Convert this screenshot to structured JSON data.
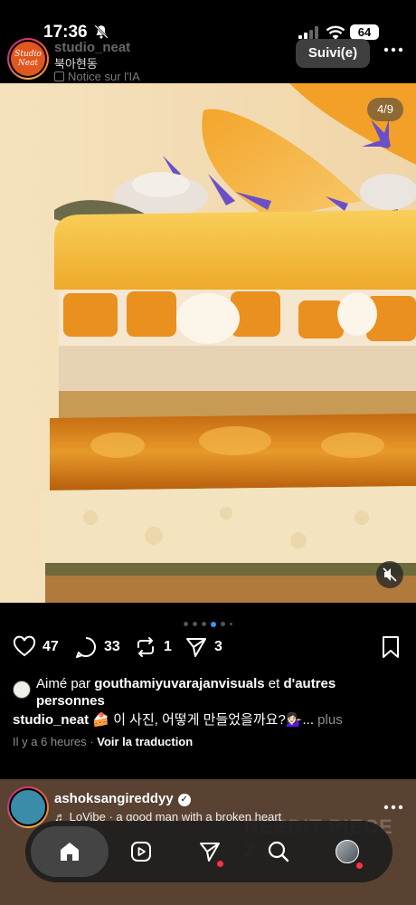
{
  "status_bar": {
    "time": "17:36",
    "battery": "64",
    "icons": [
      "bell-muted-icon",
      "signal-icon",
      "wifi-icon",
      "battery-icon"
    ]
  },
  "post": {
    "username": "studio_neat",
    "location": "북아현동",
    "ai_notice": "Notice sur l'IA",
    "avatar_text": "Studio Neat",
    "follow_label": "Suivi(e)",
    "image_counter": "4/9",
    "carousel": {
      "total_dots": 6,
      "active_index": 3
    },
    "likes": "47",
    "comments": "33",
    "reposts": "1",
    "shares": "3",
    "liked_prefix": "Aimé par",
    "liked_user": "gouthamiyuvarajanvisuals",
    "liked_suffix": "et",
    "liked_others": "d'autres personnes",
    "caption_user": "studio_neat",
    "caption_text": "🍰 이 사진, 어떻게 만들었을까요?💁🏻‍♀️...",
    "caption_more": "plus",
    "time_ago": "Il y a 6 heures",
    "separator": "·",
    "translate_label": "Voir la traduction"
  },
  "next_post": {
    "username": "ashoksangireddyy",
    "verified": "✓",
    "music_note": "♬",
    "song": "LoVibe · a good man with a broken heart",
    "bg_text": "REEDIT PIECE 2.1"
  },
  "nav": {
    "items": [
      "home-icon",
      "reels-icon",
      "send-icon",
      "search-icon",
      "profile-avatar"
    ]
  },
  "colors": {
    "background": "#000000",
    "accent_blue": "#3897f0",
    "notification_red": "#ff3040"
  }
}
